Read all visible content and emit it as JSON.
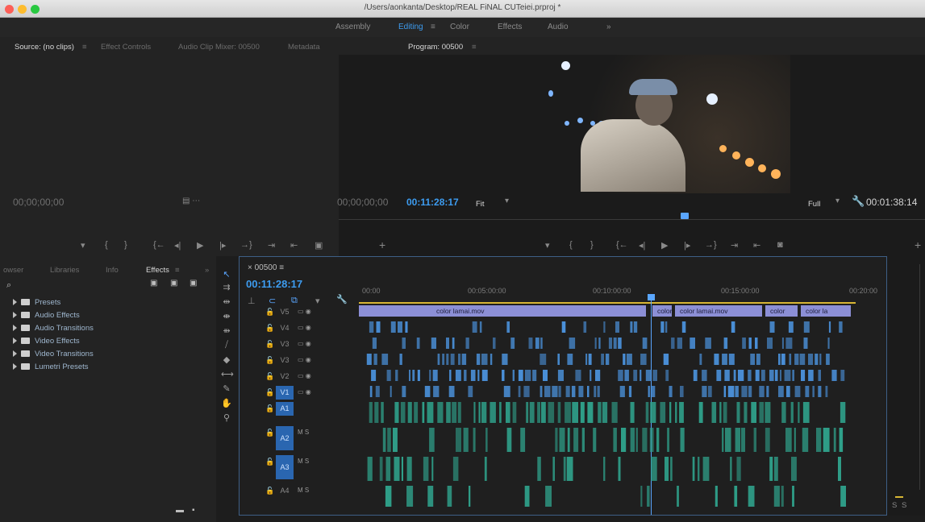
{
  "window": {
    "title": "/Users/aonkanta/Desktop/REAL FiNAL CUTeiei.prproj *"
  },
  "workspaces": [
    {
      "label": "Assembly",
      "active": false
    },
    {
      "label": "Editing",
      "active": true
    },
    {
      "label": "≡",
      "active": false
    },
    {
      "label": "Color",
      "active": false
    },
    {
      "label": "Effects",
      "active": false
    },
    {
      "label": "Audio",
      "active": false
    },
    {
      "label": "»",
      "active": false
    }
  ],
  "panel_tabs": {
    "source": "Source: (no clips)",
    "source_menu": "≡",
    "effect_controls": "Effect Controls",
    "audio_clip_mixer": "Audio Clip Mixer: 00500",
    "metadata": "Metadata",
    "program": "Program: 00500",
    "program_menu": "≡"
  },
  "source_monitor": {
    "timecode": "00;00;00;00"
  },
  "program_monitor": {
    "timecode_in": "00;00;00;00",
    "timecode_current": "00:11:28:17",
    "fit": "Fit",
    "full": "Full",
    "duration": "00:01:38:14"
  },
  "controls": {
    "left": [
      "▾",
      "{",
      "}",
      "{←",
      "◂|",
      "▶",
      "|▸",
      "→}",
      "⇥",
      "⇤",
      "▣",
      "+"
    ],
    "right": [
      "▾",
      "{",
      "}",
      "{←",
      "◂|",
      "▶",
      "|▸",
      "→}",
      "⇥",
      "⇤",
      "◙",
      "+"
    ]
  },
  "effects_panel": {
    "tabs": [
      "owser",
      "Libraries",
      "Info",
      "Effects",
      "≡",
      "»"
    ],
    "search_icon": "search-icon",
    "items": [
      "Presets",
      "Audio Effects",
      "Audio Transitions",
      "Video Effects",
      "Video Transitions",
      "Lumetri Presets"
    ]
  },
  "timeline": {
    "sequence": "00500",
    "sequence_menu": "≡",
    "timecode": "00:11:28:17",
    "ruler": [
      "00:00",
      "00:05:00:00",
      "00:10:00:00",
      "00:15:00:00",
      "00:20:00"
    ],
    "tracks": [
      {
        "name": "V5",
        "kind": "video"
      },
      {
        "name": "V4",
        "kind": "video"
      },
      {
        "name": "V3",
        "kind": "video"
      },
      {
        "name": "V3",
        "kind": "video"
      },
      {
        "name": "V2",
        "kind": "video"
      },
      {
        "name": "V1",
        "kind": "video"
      },
      {
        "name": "A1",
        "kind": "audio"
      },
      {
        "name": "A2",
        "kind": "audio"
      },
      {
        "name": "A3",
        "kind": "audio"
      },
      {
        "name": "A4",
        "kind": "audio"
      }
    ],
    "audio_buttons": "M  S",
    "v5_clips": [
      "color lamai.mov",
      "color",
      "color lamai.mov",
      "color",
      "color la"
    ]
  },
  "meter": {
    "labels": [
      "S",
      "S"
    ]
  },
  "colors": {
    "accent_blue": "#3d9cf0",
    "video_clip": "#4a90d9",
    "audio_clip": "#2fa08a",
    "v5_clip": "#8c8fd6"
  }
}
